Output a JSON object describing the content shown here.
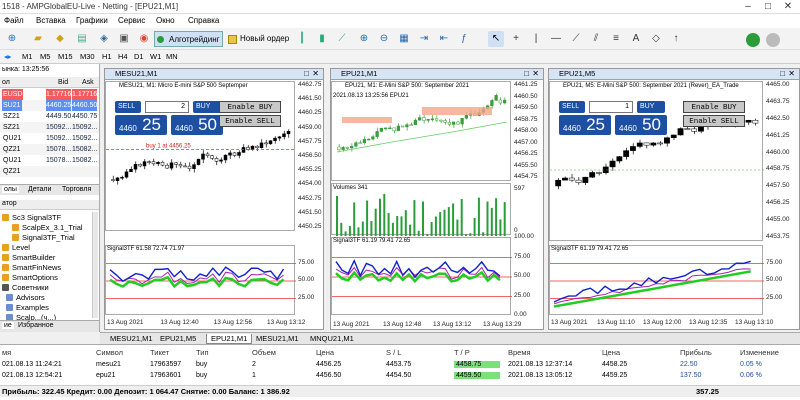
{
  "window": {
    "title": "1518 - AMPGlobalEU-Live - Netting - [EPU21,M1]"
  },
  "menu": [
    "Файл",
    "Вставка",
    "Графики",
    "Сервис",
    "Окно",
    "Справка"
  ],
  "toolbar": {
    "algo": "Алготрейдинг",
    "neworder": "Новый ордер"
  },
  "timeframes": [
    "M1",
    "M5",
    "M15",
    "M30",
    "H1",
    "H4",
    "D1",
    "W1",
    "MN"
  ],
  "market_watch": {
    "time": "ынка: 13:25:56",
    "col_symbol": "ол",
    "col_bid": "Bid",
    "col_ask": "Ask",
    "rows": [
      {
        "sym": "EUSD",
        "bid": "1.17716",
        "ask": "1.17716",
        "hl": "red"
      },
      {
        "sym": "SU21",
        "bid": "4460.25",
        "ask": "4460.50",
        "hl": "blue"
      },
      {
        "sym": "SZ21",
        "bid": "4449.50",
        "ask": "4450.75",
        "hl": ""
      },
      {
        "sym": "SZ21",
        "bid": "15092...",
        "ask": "15092...",
        "hl": ""
      },
      {
        "sym": "QU21",
        "bid": "15092...",
        "ask": "15092...",
        "hl": ""
      },
      {
        "sym": "QZ21",
        "bid": "15078...",
        "ask": "15082...",
        "hl": ""
      },
      {
        "sym": "QU21",
        "bid": "15078...",
        "ask": "15082...",
        "hl": ""
      },
      {
        "sym": "QZ21",
        "bid": "",
        "ask": "",
        "hl": ""
      }
    ],
    "tabs": [
      "олы",
      "Детали",
      "Торговля"
    ]
  },
  "navigator": {
    "header": "атор",
    "items": [
      {
        "t": "Sc3 Signal3TF",
        "c": "#e8a020"
      },
      {
        "t": "ScalpEx_3.1_Trial",
        "c": "#e8a020"
      },
      {
        "t": "Signal3TF_Trial",
        "c": "#e8a020"
      },
      {
        "t": "Level",
        "c": "#e8a020"
      },
      {
        "t": "SmartBuilder",
        "c": "#e8a020"
      },
      {
        "t": "SmartFinNews",
        "c": "#e8a020"
      },
      {
        "t": "SmartOptions",
        "c": "#e8a020"
      },
      {
        "t": "Советники",
        "c": "#555"
      },
      {
        "t": "Advisors",
        "c": "#6a8fd0"
      },
      {
        "t": "Examples",
        "c": "#6a8fd0"
      },
      {
        "t": "Scalp...(ч...)",
        "c": "#6a8fd0"
      }
    ],
    "tabs": [
      "ие",
      "Избранное"
    ]
  },
  "charts": [
    {
      "title": "MESU21,M1",
      "ohlc": "MESU21, M1: Micro E-mini S&P 500 Septemper",
      "qty": "2",
      "sell_small": "4460",
      "sell_big": "25",
      "buy_small": "4460",
      "buy_big": "50",
      "btn_buy": "Enable BUY",
      "btn_sell": "Enable SELL",
      "yticks": [
        "4462.75",
        "4461.50",
        "4460.25",
        "4459.00",
        "4457.75",
        "4456.50",
        "4455.25",
        "4454.00",
        "4452.75",
        "4451.50",
        "4450.25"
      ],
      "sig": "Signal3TF 61.58 72.74 71.97",
      "sigticks": [
        "75.00",
        "50.00",
        "25.00"
      ],
      "xticks": [
        "13 Aug 2021",
        "13 Aug 12:40",
        "13 Aug 12:56",
        "13 Aug 13:12"
      ],
      "line_label": "buy 1 at 4456.25"
    },
    {
      "title": "EPU21,M1",
      "ohlc": "EPU21, M1: E-Mini S&P 500: September 2021",
      "datetime": "2021.08.13 13:25:56 EPU21",
      "yticks": [
        "4461.25",
        "4460.50",
        "4459.50",
        "4458.75",
        "4458.00",
        "4457.00",
        "4456.25",
        "4455.50",
        "4454.75"
      ],
      "vol": "Volumes 341",
      "volticks": [
        "597",
        "0"
      ],
      "sig": "Signal3TF 61.19 79.41 72.65",
      "sigticks": [
        "100.00",
        "75.00",
        "50.00",
        "25.00",
        "0.00"
      ],
      "xticks": [
        "13 Aug 2021",
        "13 Aug 12:48",
        "13 Aug 13:12",
        "13 Aug 13:29"
      ]
    },
    {
      "title": "EPU21,M5",
      "ohlc": "EPU21, M5: E-Mini S&P 500: September 2021 (Rever)_EA_Trade",
      "qty": "1",
      "sell_small": "4460",
      "sell_big": "25",
      "buy_small": "4460",
      "buy_big": "50",
      "btn_buy": "Enable BUY",
      "btn_sell": "Enable SELL",
      "yticks": [
        "4465.00",
        "4463.75",
        "4462.50",
        "4461.25",
        "4460.00",
        "4458.75",
        "4457.50",
        "4456.25",
        "4455.00",
        "4453.75"
      ],
      "sig": "Signal3TF 61.19 79.41 72.65",
      "sigticks": [
        "75.00",
        "50.00",
        "25.00"
      ],
      "xticks": [
        "13 Aug 2021",
        "13 Aug 11:10",
        "13 Aug 12:00",
        "13 Aug 12:35",
        "13 Aug 13:10"
      ]
    }
  ],
  "chart_tabs": [
    "MESU21,M1",
    "EPU21,M5",
    "EPU21,M1",
    "MESU21,M1",
    "MNQU21,M1"
  ],
  "terminal": {
    "cols": [
      "мя",
      "Символ",
      "Тикет",
      "Тип",
      "Объем",
      "Цена",
      "S / L",
      "T / P",
      "Время",
      "Цена",
      "Прибыль",
      "Изменение"
    ],
    "rows": [
      [
        "021.08.13 11:24:21",
        "mesu21",
        "17963597",
        "buy",
        "2",
        "4456.25",
        "4453.75",
        "4458.75",
        "2021.08.13 12:37:14",
        "4458.25",
        "22.50",
        "0.05 %"
      ],
      [
        "021.08.13 12:54:21",
        "epu21",
        "17963601",
        "buy",
        "1",
        "4456.50",
        "4454.50",
        "4459.50",
        "2021.08.13 13:05:12",
        "4459.25",
        "137.50",
        "0.06 %"
      ]
    ],
    "summary": "Прибыль: 322.45  Кредит: 0.00  Депозит: 1 064.47  Снятие: 0.00  Баланс: 1 386.92",
    "total": "357.25"
  }
}
